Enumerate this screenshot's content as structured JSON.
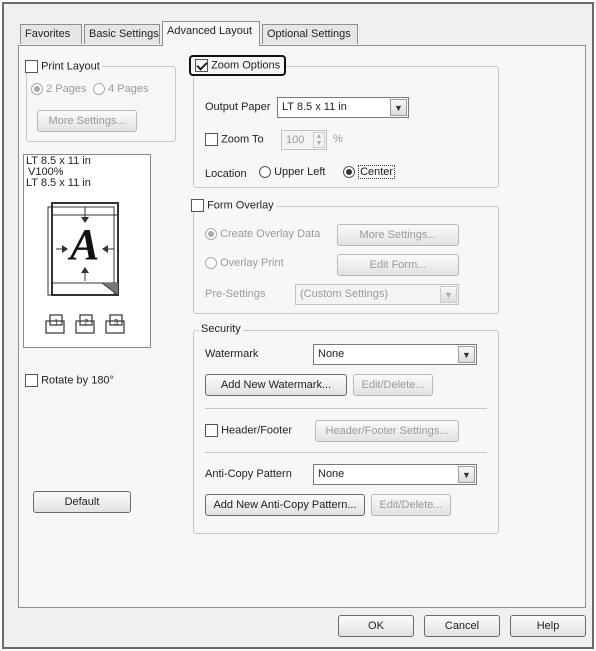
{
  "tabs": [
    {
      "label": "Favorites"
    },
    {
      "label": "Basic Settings"
    },
    {
      "label": "Advanced Layout"
    },
    {
      "label": "Optional Settings"
    }
  ],
  "print_layout": {
    "label": "Print Layout",
    "option_2_pages": "2 Pages",
    "option_4_pages": "4 Pages",
    "more_settings": "More Settings..."
  },
  "preview": {
    "line1": "LT 8.5 x 11 in",
    "line2": "V100%",
    "line3": "LT 8.5 x 11 in",
    "glyph": "A"
  },
  "rotate": {
    "label": "Rotate by 180°"
  },
  "default_button": "Default",
  "zoom": {
    "label": "Zoom Options",
    "output_paper_label": "Output Paper",
    "output_paper_value": "LT 8.5 x 11 in",
    "zoom_to_label": "Zoom To",
    "zoom_value": "100",
    "zoom_unit": "%",
    "location_label": "Location",
    "upper_left": "Upper Left",
    "center": "Center"
  },
  "form_overlay": {
    "label": "Form Overlay",
    "create": "Create Overlay Data",
    "more_settings": "More Settings...",
    "overlay_print": "Overlay Print",
    "edit_form": "Edit Form...",
    "presettings_label": "Pre-Settings",
    "presettings_value": "(Custom Settings)"
  },
  "security": {
    "label": "Security",
    "watermark_label": "Watermark",
    "watermark_value": "None",
    "add_watermark": "Add New Watermark...",
    "edit_delete_1": "Edit/Delete...",
    "header_footer_label": "Header/Footer",
    "header_footer_settings": "Header/Footer Settings...",
    "anti_copy_label": "Anti-Copy Pattern",
    "anti_copy_value": "None",
    "add_anti_copy": "Add New Anti-Copy Pattern...",
    "edit_delete_2": "Edit/Delete..."
  },
  "footer": {
    "ok": "OK",
    "cancel": "Cancel",
    "help": "Help"
  }
}
